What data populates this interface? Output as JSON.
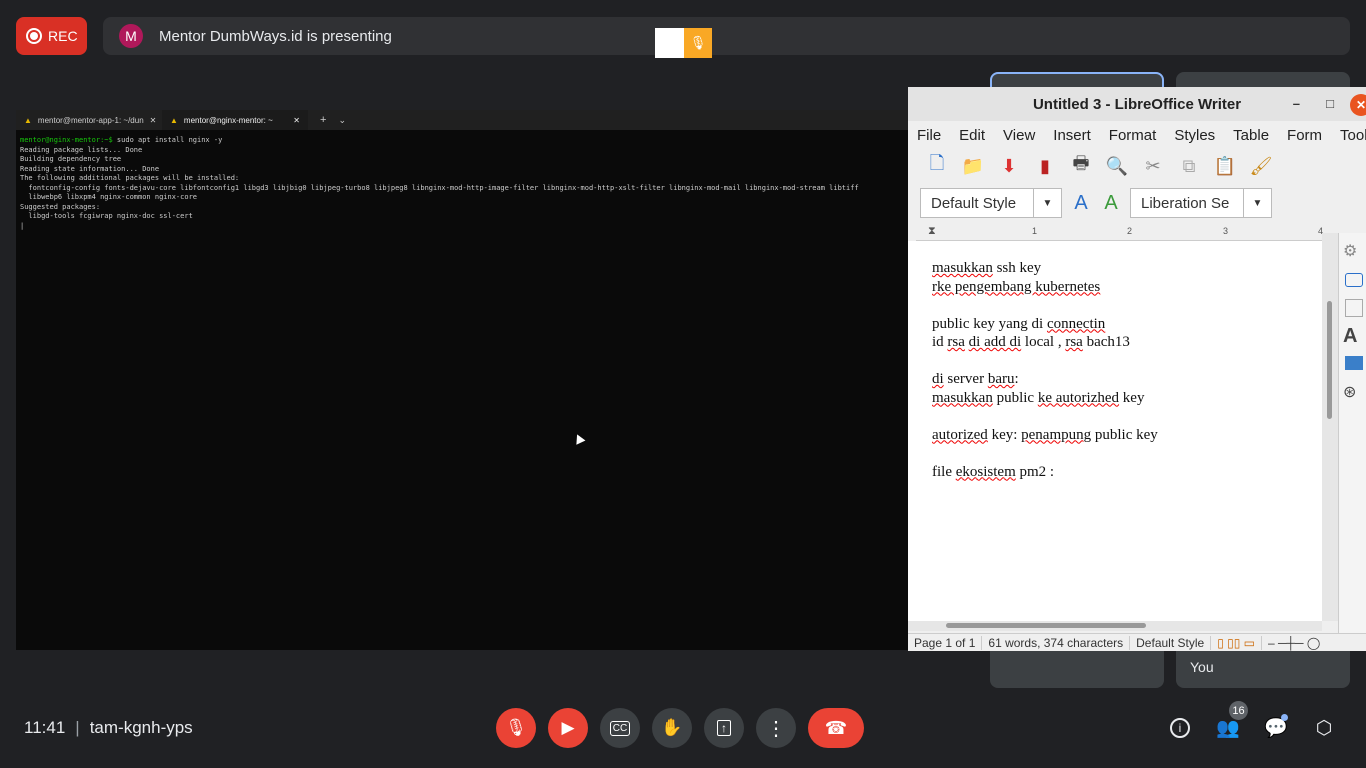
{
  "recording": {
    "label": "REC"
  },
  "presenter": {
    "initial": "M",
    "text": "Mentor DumbWays.id is presenting"
  },
  "self_tile": {
    "label": "You"
  },
  "terminal": {
    "tabs": [
      {
        "title": "mentor@mentor-app-1: ~/dun",
        "close": "✕"
      },
      {
        "title": "mentor@nginx-mentor: ~",
        "close": "✕"
      }
    ],
    "new_tab": "+",
    "dropdown": "⌄",
    "prompt": "mentor@nginx-mentor:~$",
    "command": " sudo apt install nginx -y",
    "output": [
      "Reading package lists... Done",
      "Building dependency tree",
      "Reading state information... Done",
      "The following additional packages will be installed:",
      "  fontconfig-config fonts-dejavu-core libfontconfig1 libgd3 libjbig0 libjpeg-turbo8 libjpeg8 libnginx-mod-http-image-filter libnginx-mod-http-xslt-filter libnginx-mod-mail libnginx-mod-stream libtiff",
      "  libwebp6 libxpm4 nginx-common nginx-core",
      "Suggested packages:",
      "  libgd-tools fcgiwrap nginx-doc ssl-cert",
      "|"
    ]
  },
  "writer": {
    "title": "Untitled 3 - LibreOffice Writer",
    "window_controls": {
      "minimize": "–",
      "maximize": "□",
      "close": "✕"
    },
    "menu": [
      "File",
      "Edit",
      "View",
      "Insert",
      "Format",
      "Styles",
      "Table",
      "Form",
      "Tools"
    ],
    "paragraph_style": "Default Style",
    "font_name": "Liberation Se",
    "ruler_marks": [
      "1",
      "2",
      "3",
      "4"
    ],
    "document_lines": [
      [
        {
          "t": "masukkan",
          "s": true
        },
        {
          "t": " ssh key",
          "s": false
        }
      ],
      [
        {
          "t": "rke pengembang kubernetes",
          "s": true
        }
      ],
      [],
      [
        {
          "t": "public key yang di ",
          "s": false
        },
        {
          "t": "connectin",
          "s": true
        }
      ],
      [
        {
          "t": "id ",
          "s": false
        },
        {
          "t": "rsa",
          "s": true
        },
        {
          "t": " ",
          "s": false
        },
        {
          "t": "di add di",
          "s": true
        },
        {
          "t": " local , ",
          "s": false
        },
        {
          "t": "rsa",
          "s": true
        },
        {
          "t": " bach13",
          "s": false
        }
      ],
      [],
      [
        {
          "t": "di",
          "s": true
        },
        {
          "t": " server ",
          "s": false
        },
        {
          "t": "baru",
          "s": true
        },
        {
          "t": ":",
          "s": false
        }
      ],
      [
        {
          "t": "masukkan",
          "s": true
        },
        {
          "t": " public ",
          "s": false
        },
        {
          "t": "ke autorizhed",
          "s": true
        },
        {
          "t": " key",
          "s": false
        }
      ],
      [],
      [
        {
          "t": "autorized",
          "s": true
        },
        {
          "t": " key: ",
          "s": false
        },
        {
          "t": "penampung",
          "s": true
        },
        {
          "t": " public key",
          "s": false
        }
      ],
      [],
      [
        {
          "t": "file ",
          "s": false
        },
        {
          "t": "ekosistem",
          "s": true
        },
        {
          "t": " pm2 :",
          "s": false
        }
      ]
    ],
    "status": {
      "page": "Page 1 of 1",
      "words": "61 words, 374 characters",
      "style": "Default Style"
    }
  },
  "meeting": {
    "time": "11:41",
    "separator": "|",
    "code": "tam-kgnh-yps",
    "participants_count": "16"
  },
  "icons": {
    "mic_off": "mic-off-icon",
    "cam_off": "camera-off-icon",
    "captions": "captions-icon",
    "hand": "raise-hand-icon",
    "present": "present-icon",
    "more": "more-vert-icon",
    "hangup": "call-end-icon",
    "info": "info-icon",
    "people": "people-icon",
    "chat": "chat-icon",
    "activities": "activities-icon"
  },
  "colors": {
    "danger": "#ea4335",
    "surface": "#3c4043",
    "background": "#202124",
    "accent": "#8ab4f8"
  }
}
